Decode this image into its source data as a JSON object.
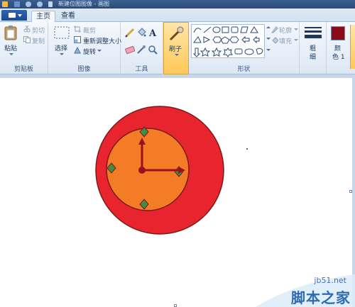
{
  "window": {
    "title": "新建位图图像 - 画图"
  },
  "tabs": [
    {
      "label": "主页",
      "active": true
    },
    {
      "label": "查看",
      "active": false
    }
  ],
  "ribbon": {
    "clipboard": {
      "paste": "粘贴",
      "cut": "剪切",
      "copy": "复制",
      "group": "剪贴板"
    },
    "image": {
      "select": "选择",
      "crop": "裁剪",
      "resize": "重新调整大小",
      "rotate": "旋转",
      "group": "图像"
    },
    "tools": {
      "group": "工具"
    },
    "brushes": {
      "label": "刷子"
    },
    "shapes": {
      "outline": "轮廓",
      "fill": "填充",
      "group": "形状"
    },
    "size": {
      "label1": "粗",
      "label2": "细"
    },
    "colors": {
      "color1_line1": "颜",
      "color1_line2": "色 1",
      "color1": "#8b0a1a"
    }
  },
  "drawing": {
    "outer_circle_color": "#e8242e",
    "inner_circle_color": "#f47c26",
    "outline_color": "#7a1a1a",
    "hand_color": "#9b1020",
    "marker_color": "#3f8e45"
  },
  "watermark": {
    "url": "jb51.net",
    "name": "脚本之家"
  }
}
